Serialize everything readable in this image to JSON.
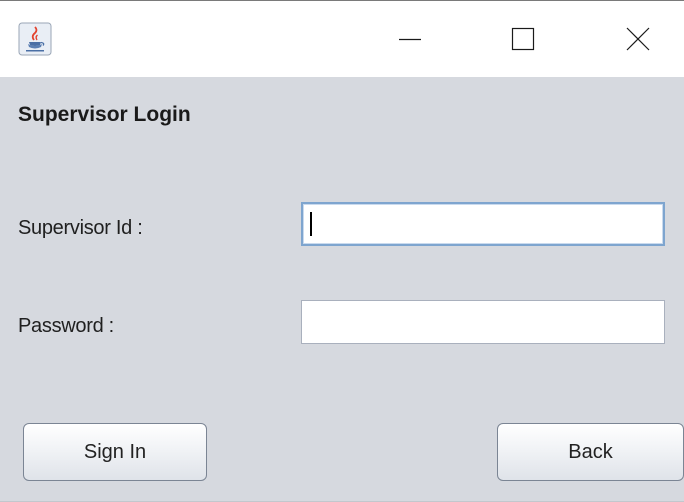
{
  "window": {
    "app_icon": "java-coffee-cup-icon",
    "controls": {
      "minimize_icon": "minimize-icon",
      "maximize_icon": "maximize-icon",
      "close_icon": "close-icon"
    }
  },
  "form": {
    "heading": "Supervisor Login",
    "supervisor_id": {
      "label": "Supervisor Id :",
      "value": ""
    },
    "password": {
      "label": "Password :",
      "value": ""
    }
  },
  "buttons": {
    "sign_in": "Sign In",
    "back": "Back"
  },
  "colors": {
    "panel_background": "#d6d9df",
    "focus_border": "#7ea5cf",
    "field_border": "#a9b0bd"
  }
}
